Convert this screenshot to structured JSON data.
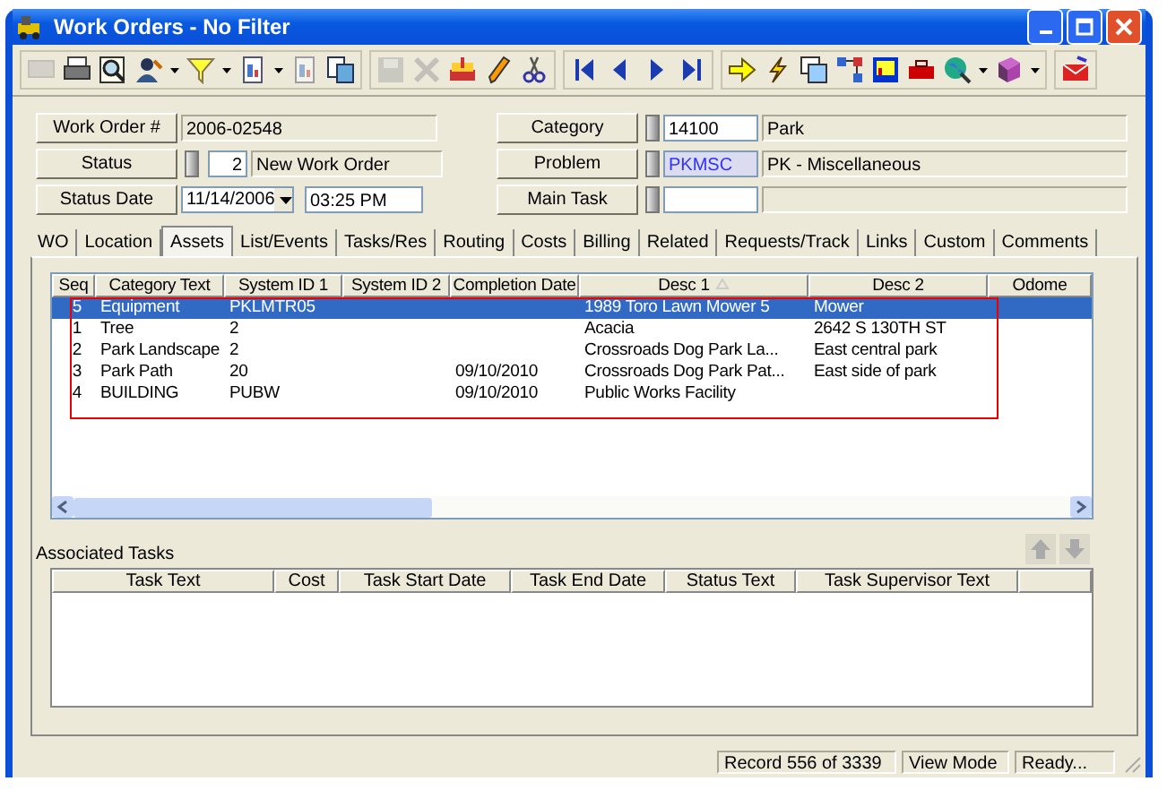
{
  "window": {
    "title": "Work Orders - No Filter"
  },
  "form": {
    "work_order": {
      "label": "Work Order #",
      "value": "2006-02548"
    },
    "status": {
      "label": "Status",
      "code": "2",
      "text": "New Work Order"
    },
    "status_date": {
      "label": "Status Date",
      "date": "11/14/2006",
      "time": "03:25 PM"
    },
    "category": {
      "label": "Category",
      "code": "14100",
      "text": "Park"
    },
    "problem": {
      "label": "Problem",
      "code": "PKMSC",
      "text": "PK - Miscellaneous"
    },
    "main_task": {
      "label": "Main Task"
    }
  },
  "tabs": [
    {
      "label": "WO",
      "selected": false
    },
    {
      "label": "Location",
      "selected": false
    },
    {
      "label": "Assets",
      "selected": true
    },
    {
      "label": "List/Events",
      "selected": false
    },
    {
      "label": "Tasks/Res",
      "selected": false
    },
    {
      "label": "Routing",
      "selected": false
    },
    {
      "label": "Costs",
      "selected": false
    },
    {
      "label": "Billing",
      "selected": false
    },
    {
      "label": "Related",
      "selected": false
    },
    {
      "label": "Requests/Track",
      "selected": false
    },
    {
      "label": "Links",
      "selected": false
    },
    {
      "label": "Custom",
      "selected": false
    },
    {
      "label": "Comments",
      "selected": false
    }
  ],
  "assets": {
    "columns": [
      "Seq",
      "Category Text",
      "System ID 1",
      "System ID 2",
      "Completion Date",
      "Desc 1",
      "Desc 2",
      "Odome"
    ],
    "rows": [
      {
        "selected": true,
        "cells": [
          "5",
          "Equipment",
          "PKLMTR05",
          "",
          "",
          "1989 Toro Lawn Mower 5",
          "Mower"
        ]
      },
      {
        "selected": false,
        "cells": [
          "1",
          "Tree",
          "2",
          "",
          "",
          "Acacia",
          "2642 S 130TH ST"
        ]
      },
      {
        "selected": false,
        "cells": [
          "2",
          "Park Landscape",
          "2",
          "",
          "",
          "Crossroads Dog Park La...",
          "East central park"
        ]
      },
      {
        "selected": false,
        "cells": [
          "3",
          "Park Path",
          "20",
          "",
          "09/10/2010",
          "Crossroads Dog Park Pat...",
          "East side of park"
        ]
      },
      {
        "selected": false,
        "cells": [
          "4",
          "BUILDING",
          "PUBW",
          "",
          "09/10/2010",
          "Public Works Facility",
          ""
        ]
      }
    ]
  },
  "associated_tasks": {
    "title": "Associated Tasks",
    "columns": [
      "Task Text",
      "Cost",
      "Task Start Date",
      "Task End Date",
      "Status Text",
      "Task Supervisor Text"
    ]
  },
  "status_bar": [
    "Record 556 of 3339",
    "View Mode",
    "Ready..."
  ]
}
